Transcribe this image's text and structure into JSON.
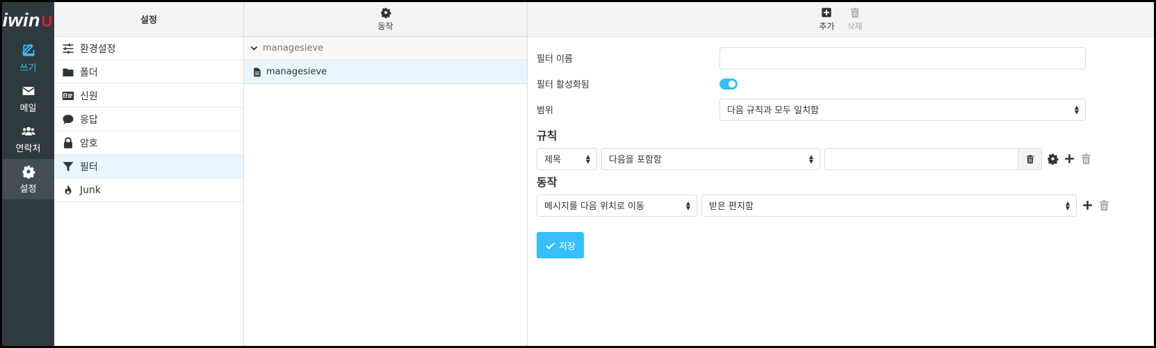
{
  "app": {
    "logo_text": "iwin",
    "logo_mark": "∪"
  },
  "rail": {
    "items": [
      {
        "label": "쓰기",
        "icon": "compose-icon"
      },
      {
        "label": "메일",
        "icon": "mail-icon"
      },
      {
        "label": "연락처",
        "icon": "contacts-icon"
      },
      {
        "label": "설정",
        "icon": "gear-icon"
      }
    ]
  },
  "settings": {
    "header": "설정",
    "items": [
      {
        "label": "환경설정",
        "icon": "sliders-icon"
      },
      {
        "label": "폴더",
        "icon": "folder-icon"
      },
      {
        "label": "신원",
        "icon": "id-card-icon"
      },
      {
        "label": "응답",
        "icon": "comment-icon"
      },
      {
        "label": "암호",
        "icon": "lock-icon"
      },
      {
        "label": "필터",
        "icon": "filter-icon"
      },
      {
        "label": "Junk",
        "icon": "fire-icon"
      }
    ]
  },
  "filtersets": {
    "toolbar_label": "동작",
    "group_label": "managesieve",
    "items": [
      {
        "label": "managesieve"
      }
    ]
  },
  "editor": {
    "toolbar": {
      "add_label": "추가",
      "delete_label": "삭제"
    },
    "name_label": "필터 이름",
    "name_value": "",
    "enabled_label": "필터 활성화됨",
    "enabled": true,
    "scope_label": "범위",
    "scope_value": "다음 규칙과 모두 일치함",
    "rules_title": "규칙",
    "rule": {
      "header": "제목",
      "operator": "다음을 포함함",
      "value": ""
    },
    "actions_title": "동작",
    "action": {
      "type": "메시지를 다음 위치로 이동",
      "target": "받은 편지함"
    },
    "save_label": "저장"
  },
  "colors": {
    "accent": "#37beff",
    "rail_bg": "#2f3a3f",
    "selected_bg": "#eaf6fd"
  }
}
